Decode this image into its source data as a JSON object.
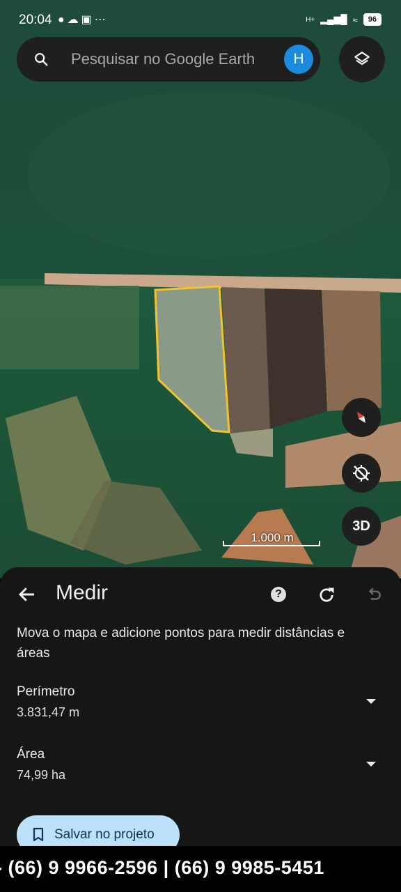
{
  "status_bar": {
    "time": "20:04",
    "notification_icons": [
      "chat-bubble-icon",
      "cloud-icon",
      "instagram-icon",
      "more-dots-icon"
    ],
    "signal_label": "H+",
    "battery": "96"
  },
  "search": {
    "placeholder": "Pesquisar no Google Earth",
    "avatar_initial": "H"
  },
  "map_controls": {
    "three_d_label": "3D",
    "scale_label": "1.000 m"
  },
  "measure_panel": {
    "title": "Medir",
    "instructions": "Mova o mapa e adicione pontos para medir distâncias e áreas",
    "perimeter_label": "Perímetro",
    "perimeter_value": "3.831,47 m",
    "area_label": "Área",
    "area_value": "74,99 ha",
    "save_button": "Salvar no projeto"
  },
  "footer_banner": {
    "text": "- (66) 9 9966-2596 | (66) 9 9985-5451"
  },
  "colors": {
    "accent_blue": "#1a8cdb",
    "save_button_bg": "#bde0fb",
    "polygon_outline": "#f2c230",
    "panel_bg": "#161616"
  }
}
